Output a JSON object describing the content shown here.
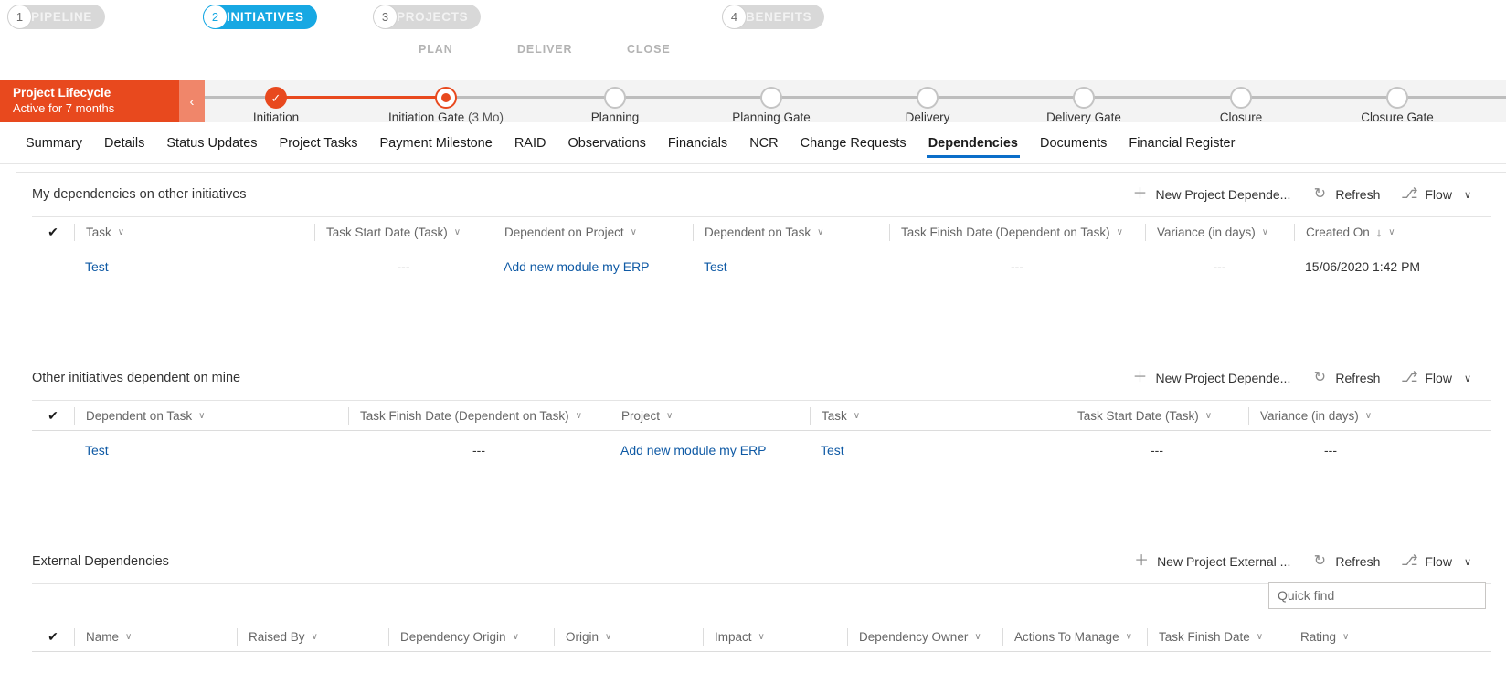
{
  "business_process": {
    "stages": [
      {
        "num": "1",
        "label": "PIPELINE",
        "active": false
      },
      {
        "num": "2",
        "label": "INITIATIVES",
        "active": true
      },
      {
        "num": "3",
        "label": "PROJECTS",
        "active": false
      },
      {
        "num": "4",
        "label": "BENEFITS",
        "active": false
      }
    ],
    "phase_labels": [
      "PLAN",
      "DELIVER",
      "CLOSE"
    ]
  },
  "lifecycle": {
    "title": "Project Lifecycle",
    "subtitle": "Active for 7 months",
    "collapse_icon": "‹",
    "check_glyph": "✓",
    "milestones": [
      {
        "label": "Initiation",
        "suffix": "",
        "state": "complete"
      },
      {
        "label": "Initiation Gate",
        "suffix": "(3 Mo)",
        "state": "current"
      },
      {
        "label": "Planning",
        "suffix": "",
        "state": "pending"
      },
      {
        "label": "Planning Gate",
        "suffix": "",
        "state": "pending"
      },
      {
        "label": "Delivery",
        "suffix": "",
        "state": "pending"
      },
      {
        "label": "Delivery Gate",
        "suffix": "",
        "state": "pending"
      },
      {
        "label": "Closure",
        "suffix": "",
        "state": "pending"
      },
      {
        "label": "Closure Gate",
        "suffix": "",
        "state": "pending"
      }
    ]
  },
  "tabs": [
    {
      "label": "Summary",
      "active": false
    },
    {
      "label": "Details",
      "active": false
    },
    {
      "label": "Status Updates",
      "active": false
    },
    {
      "label": "Project Tasks",
      "active": false
    },
    {
      "label": "Payment Milestone",
      "active": false
    },
    {
      "label": "RAID",
      "active": false
    },
    {
      "label": "Observations",
      "active": false
    },
    {
      "label": "Financials",
      "active": false
    },
    {
      "label": "NCR",
      "active": false
    },
    {
      "label": "Change Requests",
      "active": false
    },
    {
      "label": "Dependencies",
      "active": true
    },
    {
      "label": "Documents",
      "active": false
    },
    {
      "label": "Financial Register",
      "active": false
    }
  ],
  "commands": {
    "new_dependency": "New Project Depende...",
    "new_external": "New Project External ...",
    "refresh": "Refresh",
    "flow": "Flow",
    "plus_icon": "＋",
    "refresh_icon": "↻",
    "flow_icon": "⎇",
    "chevron": "∨"
  },
  "grids": [
    {
      "title": "My dependencies on other initiatives",
      "new_label": "New Project Depende...",
      "columns": [
        {
          "label": "Task",
          "sorted": false
        },
        {
          "label": "Task Start Date (Task)",
          "sorted": false
        },
        {
          "label": "Dependent on Project",
          "sorted": false
        },
        {
          "label": "Dependent on Task",
          "sorted": false
        },
        {
          "label": "Task Finish Date (Dependent on Task)",
          "sorted": false
        },
        {
          "label": "Variance (in days)",
          "sorted": false
        },
        {
          "label": "Created On",
          "sorted": true,
          "sort_glyph": "↓"
        }
      ],
      "rows": [
        {
          "cells": [
            {
              "value": "Test",
              "link": true
            },
            {
              "value": "---",
              "link": false
            },
            {
              "value": "Add new module my ERP",
              "link": true
            },
            {
              "value": "Test",
              "link": true
            },
            {
              "value": "---",
              "link": false
            },
            {
              "value": "---",
              "link": false
            },
            {
              "value": "15/06/2020 1:42 PM",
              "link": false
            }
          ]
        }
      ]
    },
    {
      "title": "Other initiatives dependent on mine",
      "new_label": "New Project Depende...",
      "columns": [
        {
          "label": "Dependent on Task",
          "sorted": false
        },
        {
          "label": "Task Finish Date (Dependent on Task)",
          "sorted": false
        },
        {
          "label": "Project",
          "sorted": false
        },
        {
          "label": "Task",
          "sorted": false
        },
        {
          "label": "Task Start Date (Task)",
          "sorted": false
        },
        {
          "label": "Variance (in days)",
          "sorted": false
        }
      ],
      "rows": [
        {
          "cells": [
            {
              "value": "Test",
              "link": true
            },
            {
              "value": "---",
              "link": false
            },
            {
              "value": "Add new module my ERP",
              "link": true
            },
            {
              "value": "Test",
              "link": true
            },
            {
              "value": "---",
              "link": false
            },
            {
              "value": "---",
              "link": false
            }
          ]
        }
      ]
    },
    {
      "title": "External Dependencies",
      "new_label": "New Project External ...",
      "quick_find_placeholder": "Quick find",
      "quick_find_value": "",
      "columns": [
        {
          "label": "Name",
          "sorted": false
        },
        {
          "label": "Raised By",
          "sorted": false
        },
        {
          "label": "Dependency Origin",
          "sorted": false
        },
        {
          "label": "Origin",
          "sorted": false
        },
        {
          "label": "Impact",
          "sorted": false
        },
        {
          "label": "Dependency Owner",
          "sorted": false
        },
        {
          "label": "Actions To Manage",
          "sorted": false
        },
        {
          "label": "Task Finish Date",
          "sorted": false
        },
        {
          "label": "Rating",
          "sorted": false
        }
      ],
      "rows": []
    }
  ],
  "colors": {
    "accent_blue": "#17a8e3",
    "tab_active_underline": "#0b6ec9",
    "lifecycle_orange": "#e8491e",
    "link_blue": "#0f5aa5"
  },
  "icons": {
    "check": "✓",
    "select_all_check": "✔"
  }
}
